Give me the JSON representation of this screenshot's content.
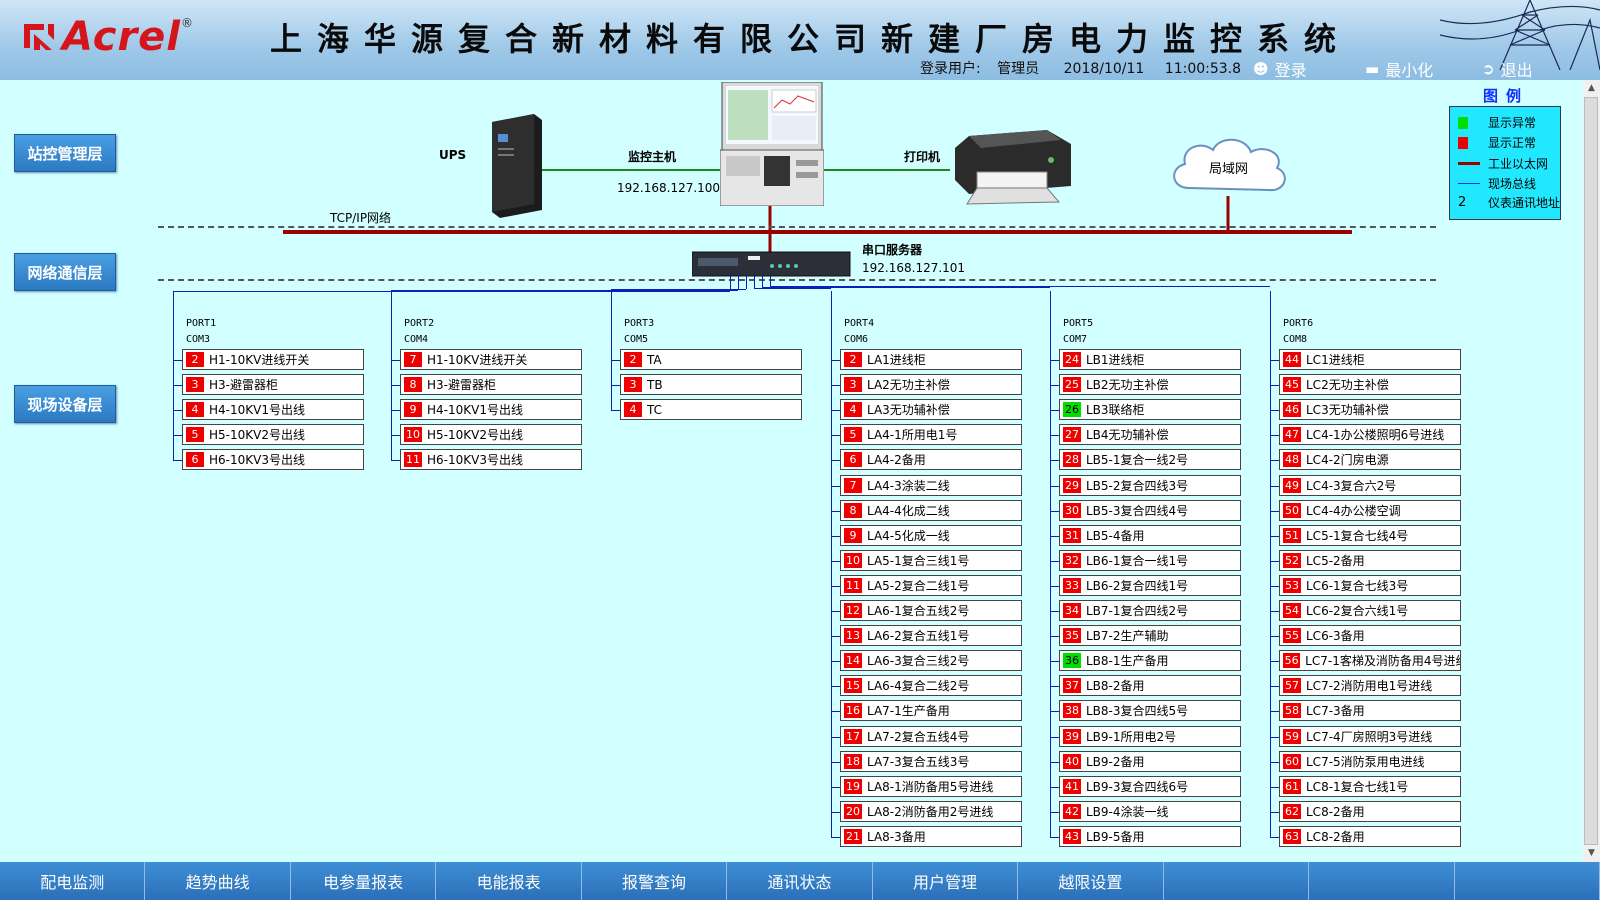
{
  "header": {
    "logo_text": "Acrel",
    "logo_reg": "®",
    "title": "上海华源复合新材料有限公司新建厂房电力监控系统",
    "user_label": "登录用户:",
    "user_name": "管理员",
    "date": "2018/10/11",
    "time": "11:00:53.8",
    "login_label": "登录",
    "minimize_label": "最小化",
    "exit_label": "退出"
  },
  "layers": [
    "站控管理层",
    "网络通信层",
    "现场设备层"
  ],
  "network": {
    "ups_label": "UPS",
    "host_label": "监控主机",
    "host_ip": "192.168.127.100",
    "printer_label": "打印机",
    "lan_label": "局域网",
    "tcpip_label": "TCP/IP网络",
    "serial_label": "串口服务器",
    "serial_ip": "192.168.127.101"
  },
  "legend": {
    "title": "图例",
    "items": [
      {
        "label": "显示异常",
        "color": "#00dd00"
      },
      {
        "label": "显示正常",
        "color": "#ee0000"
      },
      {
        "label": "工业以太网",
        "color": "#990000"
      },
      {
        "label": "现场总线",
        "color": "#1030ff"
      },
      {
        "label": "仪表通讯地址",
        "symbol": "2"
      }
    ]
  },
  "ports": [
    {
      "port": "PORT1",
      "com": "COM3",
      "devices": [
        {
          "addr": "2",
          "name": "H1-10KV进线开关",
          "state": "normal"
        },
        {
          "addr": "3",
          "name": "H3-避雷器柜",
          "state": "normal"
        },
        {
          "addr": "4",
          "name": "H4-10KV1号出线",
          "state": "normal"
        },
        {
          "addr": "5",
          "name": "H5-10KV2号出线",
          "state": "normal"
        },
        {
          "addr": "6",
          "name": "H6-10KV3号出线",
          "state": "normal"
        }
      ]
    },
    {
      "port": "PORT2",
      "com": "COM4",
      "devices": [
        {
          "addr": "7",
          "name": "H1-10KV进线开关",
          "state": "normal"
        },
        {
          "addr": "8",
          "name": "H3-避雷器柜",
          "state": "normal"
        },
        {
          "addr": "9",
          "name": "H4-10KV1号出线",
          "state": "normal"
        },
        {
          "addr": "10",
          "name": "H5-10KV2号出线",
          "state": "normal"
        },
        {
          "addr": "11",
          "name": "H6-10KV3号出线",
          "state": "normal"
        }
      ]
    },
    {
      "port": "PORT3",
      "com": "COM5",
      "devices": [
        {
          "addr": "2",
          "name": "TA",
          "state": "normal"
        },
        {
          "addr": "3",
          "name": "TB",
          "state": "normal"
        },
        {
          "addr": "4",
          "name": "TC",
          "state": "normal"
        }
      ]
    },
    {
      "port": "PORT4",
      "com": "COM6",
      "devices": [
        {
          "addr": "2",
          "name": "LA1进线柜",
          "state": "normal"
        },
        {
          "addr": "3",
          "name": "LA2无功主补偿",
          "state": "normal"
        },
        {
          "addr": "4",
          "name": "LA3无功辅补偿",
          "state": "normal"
        },
        {
          "addr": "5",
          "name": "LA4-1所用电1号",
          "state": "normal"
        },
        {
          "addr": "6",
          "name": "LA4-2备用",
          "state": "normal"
        },
        {
          "addr": "7",
          "name": "LA4-3涂装二线",
          "state": "normal"
        },
        {
          "addr": "8",
          "name": "LA4-4化成二线",
          "state": "normal"
        },
        {
          "addr": "9",
          "name": "LA4-5化成一线",
          "state": "normal"
        },
        {
          "addr": "10",
          "name": "LA5-1复合三线1号",
          "state": "normal"
        },
        {
          "addr": "11",
          "name": "LA5-2复合二线1号",
          "state": "normal"
        },
        {
          "addr": "12",
          "name": "LA6-1复合五线2号",
          "state": "normal"
        },
        {
          "addr": "13",
          "name": "LA6-2复合五线1号",
          "state": "normal"
        },
        {
          "addr": "14",
          "name": "LA6-3复合三线2号",
          "state": "normal"
        },
        {
          "addr": "15",
          "name": "LA6-4复合二线2号",
          "state": "normal"
        },
        {
          "addr": "16",
          "name": "LA7-1生产备用",
          "state": "normal"
        },
        {
          "addr": "17",
          "name": "LA7-2复合五线4号",
          "state": "normal"
        },
        {
          "addr": "18",
          "name": "LA7-3复合五线3号",
          "state": "normal"
        },
        {
          "addr": "19",
          "name": "LA8-1消防备用5号进线",
          "state": "normal"
        },
        {
          "addr": "20",
          "name": "LA8-2消防备用2号进线",
          "state": "normal"
        },
        {
          "addr": "21",
          "name": "LA8-3备用",
          "state": "normal"
        }
      ]
    },
    {
      "port": "PORT5",
      "com": "COM7",
      "devices": [
        {
          "addr": "24",
          "name": "LB1进线柜",
          "state": "normal"
        },
        {
          "addr": "25",
          "name": "LB2无功主补偿",
          "state": "normal"
        },
        {
          "addr": "26",
          "name": "LB3联络柜",
          "state": "abnormal"
        },
        {
          "addr": "27",
          "name": "LB4无功辅补偿",
          "state": "normal"
        },
        {
          "addr": "28",
          "name": "LB5-1复合一线2号",
          "state": "normal"
        },
        {
          "addr": "29",
          "name": "LB5-2复合四线3号",
          "state": "normal"
        },
        {
          "addr": "30",
          "name": "LB5-3复合四线4号",
          "state": "normal"
        },
        {
          "addr": "31",
          "name": "LB5-4备用",
          "state": "normal"
        },
        {
          "addr": "32",
          "name": "LB6-1复合一线1号",
          "state": "normal"
        },
        {
          "addr": "33",
          "name": "LB6-2复合四线1号",
          "state": "normal"
        },
        {
          "addr": "34",
          "name": "LB7-1复合四线2号",
          "state": "normal"
        },
        {
          "addr": "35",
          "name": "LB7-2生产辅助",
          "state": "normal"
        },
        {
          "addr": "36",
          "name": "LB8-1生产备用",
          "state": "abnormal"
        },
        {
          "addr": "37",
          "name": "LB8-2备用",
          "state": "normal"
        },
        {
          "addr": "38",
          "name": "LB8-3复合四线5号",
          "state": "normal"
        },
        {
          "addr": "39",
          "name": "LB9-1所用电2号",
          "state": "normal"
        },
        {
          "addr": "40",
          "name": "LB9-2备用",
          "state": "normal"
        },
        {
          "addr": "41",
          "name": "LB9-3复合四线6号",
          "state": "normal"
        },
        {
          "addr": "42",
          "name": "LB9-4涂装一线",
          "state": "normal"
        },
        {
          "addr": "43",
          "name": "LB9-5备用",
          "state": "normal"
        }
      ]
    },
    {
      "port": "PORT6",
      "com": "COM8",
      "devices": [
        {
          "addr": "44",
          "name": "LC1进线柜",
          "state": "normal"
        },
        {
          "addr": "45",
          "name": "LC2无功主补偿",
          "state": "normal"
        },
        {
          "addr": "46",
          "name": "LC3无功辅补偿",
          "state": "normal"
        },
        {
          "addr": "47",
          "name": "LC4-1办公楼照明6号进线",
          "state": "normal"
        },
        {
          "addr": "48",
          "name": "LC4-2门房电源",
          "state": "normal"
        },
        {
          "addr": "49",
          "name": "LC4-3复合六2号",
          "state": "normal"
        },
        {
          "addr": "50",
          "name": "LC4-4办公楼空调",
          "state": "normal"
        },
        {
          "addr": "51",
          "name": "LC5-1复合七线4号",
          "state": "normal"
        },
        {
          "addr": "52",
          "name": "LC5-2备用",
          "state": "normal"
        },
        {
          "addr": "53",
          "name": "LC6-1复合七线3号",
          "state": "normal"
        },
        {
          "addr": "54",
          "name": "LC6-2复合六线1号",
          "state": "normal"
        },
        {
          "addr": "55",
          "name": "LC6-3备用",
          "state": "normal"
        },
        {
          "addr": "56",
          "name": "LC7-1客梯及消防备用4号进线",
          "state": "normal"
        },
        {
          "addr": "57",
          "name": "LC7-2消防用电1号进线",
          "state": "normal"
        },
        {
          "addr": "58",
          "name": "LC7-3备用",
          "state": "normal"
        },
        {
          "addr": "59",
          "name": "LC7-4厂房照明3号进线",
          "state": "normal"
        },
        {
          "addr": "60",
          "name": "LC7-5消防泵用电进线",
          "state": "normal"
        },
        {
          "addr": "61",
          "name": "LC8-1复合七线1号",
          "state": "normal"
        },
        {
          "addr": "62",
          "name": "LC8-2备用",
          "state": "normal"
        },
        {
          "addr": "63",
          "name": "LC8-2备用",
          "state": "normal"
        }
      ]
    }
  ],
  "nav": [
    "配电监测",
    "趋势曲线",
    "电参量报表",
    "电能报表",
    "报警查询",
    "通讯状态",
    "用户管理",
    "越限设置",
    "",
    "",
    ""
  ]
}
